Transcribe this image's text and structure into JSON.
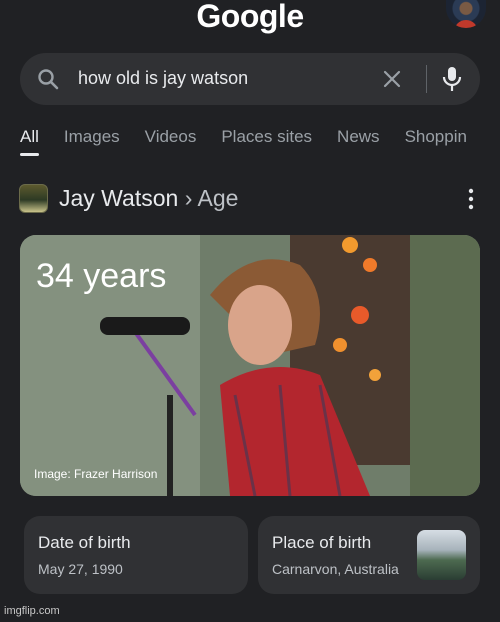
{
  "header": {
    "logo_text": "Google",
    "avatar_icon": "user-avatar"
  },
  "search": {
    "query": "how old is jay watson",
    "search_icon": "search-icon",
    "clear_icon": "close-icon",
    "voice_icon": "microphone-icon"
  },
  "tabs": [
    {
      "label": "All",
      "active": true
    },
    {
      "label": "Images",
      "active": false
    },
    {
      "label": "Videos",
      "active": false
    },
    {
      "label": "Places sites",
      "active": false
    },
    {
      "label": "News",
      "active": false
    },
    {
      "label": "Shoppin",
      "active": false
    }
  ],
  "result": {
    "entity": "Jay Watson",
    "separator": "›",
    "attribute": "Age",
    "more_icon": "more-vert-icon"
  },
  "hero": {
    "age_text": "34 years",
    "credit": "Image: Frazer Harrison"
  },
  "cards": {
    "dob": {
      "label": "Date of birth",
      "value": "May 27, 1990"
    },
    "pob": {
      "label": "Place of birth",
      "value": "Carnarvon, Australia"
    }
  },
  "watermark": "imgflip.com",
  "colors": {
    "background": "#202124",
    "surface": "#303134",
    "text_primary": "#e8eaed",
    "text_secondary": "#9aa0a6"
  }
}
